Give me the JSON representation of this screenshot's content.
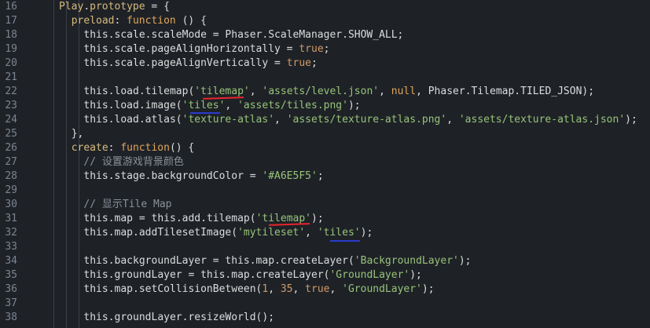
{
  "editor": {
    "lines": [
      {
        "num": "16",
        "indent": 2,
        "tokens": [
          [
            "prop",
            "Play"
          ],
          [
            "punc",
            "."
          ],
          [
            "prop",
            "prototype"
          ],
          [
            "punc",
            " = {"
          ]
        ]
      },
      {
        "num": "17",
        "indent": 4,
        "tokens": [
          [
            "prop",
            "preload"
          ],
          [
            "punc",
            ": "
          ],
          [
            "kw",
            "function"
          ],
          [
            "punc",
            " () {"
          ]
        ]
      },
      {
        "num": "18",
        "indent": 6,
        "tokens": [
          [
            "this",
            "this"
          ],
          [
            "punc",
            ".scale.scaleMode = Phaser.ScaleManager.SHOW_ALL;"
          ]
        ]
      },
      {
        "num": "19",
        "indent": 6,
        "tokens": [
          [
            "this",
            "this"
          ],
          [
            "punc",
            ".scale.pageAlignHorizontally = "
          ],
          [
            "bool",
            "true"
          ],
          [
            "punc",
            ";"
          ]
        ]
      },
      {
        "num": "20",
        "indent": 6,
        "tokens": [
          [
            "this",
            "this"
          ],
          [
            "punc",
            ".scale.pageAlignVertically = "
          ],
          [
            "bool",
            "true"
          ],
          [
            "punc",
            ";"
          ]
        ]
      },
      {
        "num": "21",
        "indent": 0,
        "tokens": []
      },
      {
        "num": "22",
        "indent": 6,
        "tokens": [
          [
            "this",
            "this"
          ],
          [
            "punc",
            ".load.tilemap("
          ],
          [
            "str",
            "'tilemap'"
          ],
          [
            "punc",
            ", "
          ],
          [
            "str",
            "'assets/level.json'"
          ],
          [
            "punc",
            ", "
          ],
          [
            "kw",
            "null"
          ],
          [
            "punc",
            ", Phaser.Tilemap.TILED_JSON);"
          ]
        ]
      },
      {
        "num": "23",
        "indent": 6,
        "tokens": [
          [
            "this",
            "this"
          ],
          [
            "punc",
            ".load.image("
          ],
          [
            "str",
            "'tiles'"
          ],
          [
            "punc",
            ", "
          ],
          [
            "str",
            "'assets/tiles.png'"
          ],
          [
            "punc",
            ");"
          ]
        ]
      },
      {
        "num": "24",
        "indent": 6,
        "tokens": [
          [
            "this",
            "this"
          ],
          [
            "punc",
            ".load.atlas("
          ],
          [
            "str",
            "'texture-atlas'"
          ],
          [
            "punc",
            ", "
          ],
          [
            "str",
            "'assets/texture-atlas.png'"
          ],
          [
            "punc",
            ", "
          ],
          [
            "str",
            "'assets/texture-atlas.json'"
          ],
          [
            "punc",
            ");"
          ]
        ]
      },
      {
        "num": "25",
        "indent": 4,
        "tokens": [
          [
            "punc",
            "},"
          ]
        ]
      },
      {
        "num": "26",
        "indent": 4,
        "tokens": [
          [
            "prop",
            "create"
          ],
          [
            "punc",
            ": "
          ],
          [
            "kw",
            "function"
          ],
          [
            "punc",
            "() {"
          ]
        ]
      },
      {
        "num": "27",
        "indent": 6,
        "tokens": [
          [
            "com",
            "// 设置游戏背景颜色"
          ]
        ]
      },
      {
        "num": "28",
        "indent": 6,
        "tokens": [
          [
            "this",
            "this"
          ],
          [
            "punc",
            ".stage.backgroundColor = "
          ],
          [
            "str",
            "'#A6E5F5'"
          ],
          [
            "punc",
            ";"
          ]
        ]
      },
      {
        "num": "29",
        "indent": 0,
        "tokens": []
      },
      {
        "num": "30",
        "indent": 6,
        "tokens": [
          [
            "com",
            "// 显示Tile Map"
          ]
        ]
      },
      {
        "num": "31",
        "indent": 6,
        "tokens": [
          [
            "this",
            "this"
          ],
          [
            "punc",
            ".map = "
          ],
          [
            "this",
            "this"
          ],
          [
            "punc",
            ".add.tilemap("
          ],
          [
            "str",
            "'tilemap'"
          ],
          [
            "punc",
            ");"
          ]
        ]
      },
      {
        "num": "32",
        "indent": 6,
        "tokens": [
          [
            "this",
            "this"
          ],
          [
            "punc",
            ".map.addTilesetImage("
          ],
          [
            "str",
            "'mytileset'"
          ],
          [
            "punc",
            ", "
          ],
          [
            "str",
            "'tiles'"
          ],
          [
            "punc",
            ");"
          ]
        ]
      },
      {
        "num": "33",
        "indent": 0,
        "tokens": []
      },
      {
        "num": "34",
        "indent": 6,
        "tokens": [
          [
            "this",
            "this"
          ],
          [
            "punc",
            ".backgroundLayer = "
          ],
          [
            "this",
            "this"
          ],
          [
            "punc",
            ".map.createLayer("
          ],
          [
            "str",
            "'BackgroundLayer'"
          ],
          [
            "punc",
            ");"
          ]
        ]
      },
      {
        "num": "35",
        "indent": 6,
        "tokens": [
          [
            "this",
            "this"
          ],
          [
            "punc",
            ".groundLayer = "
          ],
          [
            "this",
            "this"
          ],
          [
            "punc",
            ".map.createLayer("
          ],
          [
            "str",
            "'GroundLayer'"
          ],
          [
            "punc",
            ");"
          ]
        ]
      },
      {
        "num": "36",
        "indent": 6,
        "tokens": [
          [
            "this",
            "this"
          ],
          [
            "punc",
            ".map.setCollisionBetween("
          ],
          [
            "num",
            "1"
          ],
          [
            "punc",
            ", "
          ],
          [
            "num",
            "35"
          ],
          [
            "punc",
            ", "
          ],
          [
            "bool",
            "true"
          ],
          [
            "punc",
            ", "
          ],
          [
            "str",
            "'GroundLayer'"
          ],
          [
            "punc",
            ");"
          ]
        ]
      },
      {
        "num": "37",
        "indent": 0,
        "tokens": []
      },
      {
        "num": "38",
        "indent": 6,
        "tokens": [
          [
            "this",
            "this"
          ],
          [
            "punc",
            ".groundLayer.resizeWorld();"
          ]
        ]
      }
    ]
  },
  "colors": {
    "background": "#1e2227",
    "keyword": "#e0a55a",
    "string": "#98c379",
    "comment": "#8a9199",
    "annotation_red": "#e8262b",
    "annotation_blue": "#2a3ccb"
  }
}
